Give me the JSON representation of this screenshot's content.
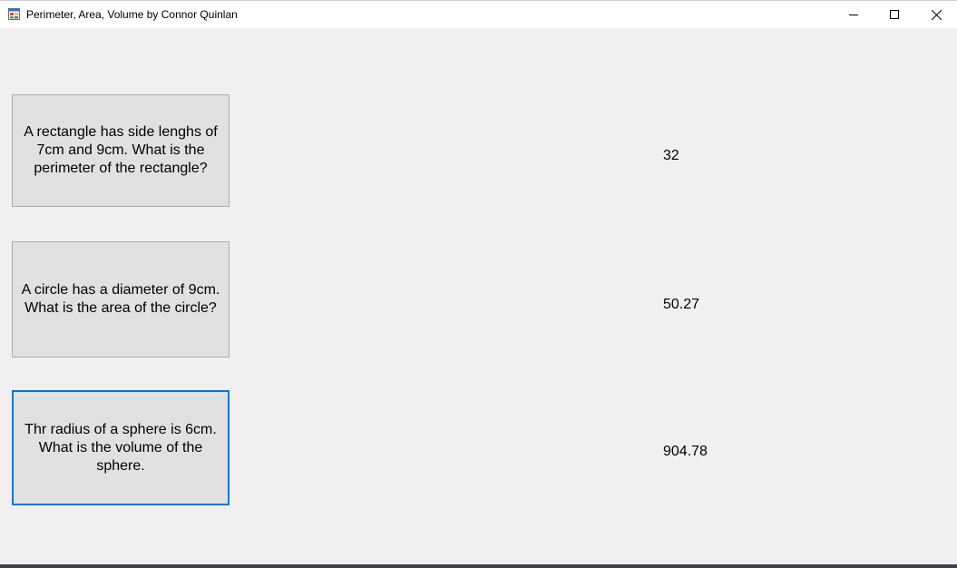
{
  "window": {
    "title": "Perimeter, Area, Volume by Connor Quinlan",
    "icon": "winforms-app-icon",
    "controls": {
      "minimize": "minimize-icon",
      "maximize": "maximize-icon",
      "close": "close-icon"
    }
  },
  "questions": [
    {
      "label": "A rectangle has side lenghs of 7cm and 9cm. What is the perimeter of the rectangle?",
      "answer": "32"
    },
    {
      "label": "A circle has a diameter of 9cm. What is the area of the circle?",
      "answer": "50.27"
    },
    {
      "label": "Thr radius of a sphere is 6cm. What is the volume of the sphere.",
      "answer": "904.78"
    }
  ],
  "colors": {
    "window_bg": "#f0f0f0",
    "button_bg": "#e1e1e1",
    "button_border": "#adadad",
    "focus_border": "#0078d7"
  }
}
